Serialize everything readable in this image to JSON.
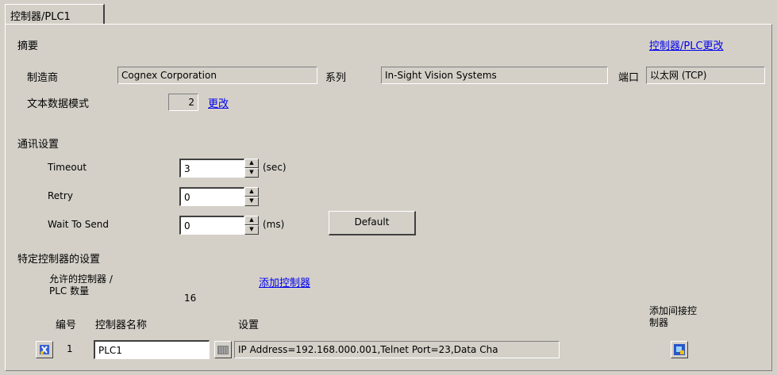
{
  "tab": {
    "label": "控制器/PLC1"
  },
  "summary": {
    "heading": "摘要",
    "change_link": "控制器/PLC更改",
    "manufacturer_label": "制造商",
    "manufacturer_value": "Cognex Corporation",
    "series_label": "系列",
    "series_value": "In-Sight Vision Systems",
    "port_label": "端口",
    "port_value": "以太网 (TCP)",
    "text_mode_label": "文本数据模式",
    "text_mode_value": "2",
    "text_mode_change": "更改"
  },
  "comm": {
    "heading": "通讯设置",
    "timeout_label": "Timeout",
    "timeout_value": "3",
    "timeout_unit": "(sec)",
    "retry_label": "Retry",
    "retry_value": "0",
    "wait_label": "Wait To Send",
    "wait_value": "0",
    "wait_unit": "(ms)",
    "default_button": "Default"
  },
  "device": {
    "heading": "特定控制器的设置",
    "allowed_label_line1": "允许的控制器 /",
    "allowed_label_line2": "PLC 数量",
    "allowed_count": "16",
    "add_link": "添加控制器",
    "col_number": "编号",
    "col_name": "控制器名称",
    "col_settings": "设置",
    "col_indirect_line1": "添加间接控",
    "col_indirect_line2": "制器",
    "rows": [
      {
        "number": "1",
        "name": "PLC1",
        "settings": "IP Address=192.168.000.001,Telnet Port=23,Data Cha"
      }
    ]
  }
}
